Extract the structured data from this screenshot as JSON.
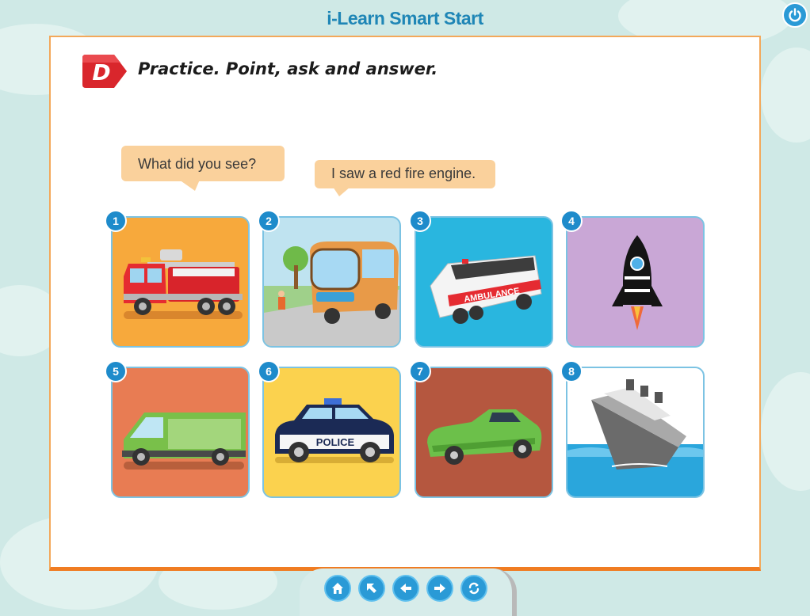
{
  "header": {
    "app_title": "i-Learn Smart Start"
  },
  "controls": {
    "power_icon": "power-icon"
  },
  "activity": {
    "letter": "D",
    "instruction": "Practice. Point, ask and answer.",
    "question_bubble": "What did you see?",
    "answer_bubble": "I saw a red fire engine."
  },
  "cards": [
    {
      "number": "1",
      "subject": "fire engine",
      "bg": "#f7a93c"
    },
    {
      "number": "2",
      "subject": "bus",
      "bg": "#bfe3f0"
    },
    {
      "number": "3",
      "subject": "ambulance",
      "bg": "#29b6df",
      "vehicle_text": "AMBULANCE"
    },
    {
      "number": "4",
      "subject": "rocket",
      "bg": "#c9a7d6"
    },
    {
      "number": "5",
      "subject": "van",
      "bg": "#e87c53"
    },
    {
      "number": "6",
      "subject": "police car",
      "bg": "#fbd24e",
      "vehicle_text": "POLICE"
    },
    {
      "number": "7",
      "subject": "car",
      "bg": "#b5573f"
    },
    {
      "number": "8",
      "subject": "ship",
      "bg": "#ffffff"
    }
  ],
  "navigation": {
    "buttons": [
      {
        "name": "home-button",
        "icon": "home-icon"
      },
      {
        "name": "back-to-menu-button",
        "icon": "arrow-up-left-icon"
      },
      {
        "name": "previous-button",
        "icon": "arrow-left-icon"
      },
      {
        "name": "next-button",
        "icon": "arrow-right-icon"
      },
      {
        "name": "replay-button",
        "icon": "refresh-icon"
      }
    ]
  },
  "colors": {
    "accent_blue": "#1e8bcb",
    "page_border": "#f3a85a",
    "bubble": "#fad19c",
    "badge_red": "#d9262c"
  }
}
